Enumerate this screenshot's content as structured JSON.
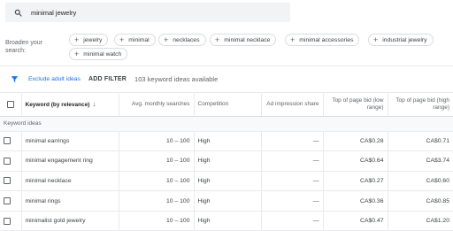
{
  "search": {
    "query": "minimal jewelry"
  },
  "broaden": {
    "label": "Broaden your search:",
    "chips": [
      {
        "label": "jewelry"
      },
      {
        "label": "minimal"
      },
      {
        "label": "necklaces"
      },
      {
        "label": "minimal necklace"
      },
      {
        "label": "minimal accessories"
      },
      {
        "label": "industrial jewelry"
      },
      {
        "label": "minimal watch"
      }
    ]
  },
  "toolbar": {
    "exclude_adult": "Exclude adult ideas",
    "add_filter": "ADD FILTER",
    "available": "103 keyword ideas available"
  },
  "table": {
    "headers": {
      "keyword": "Keyword (by relevance)",
      "searches": "Avg. monthly searches",
      "competition": "Competition",
      "impression": "Ad impression share",
      "bid_low": "Top of page bid (low range)",
      "bid_high": "Top of page bid (high range)"
    },
    "group_label": "Keyword ideas",
    "rows": [
      {
        "keyword": "minimal earrings",
        "searches": "10 – 100",
        "competition": "High",
        "impression": "—",
        "bid_low": "CA$0.28",
        "bid_high": "CA$0.71"
      },
      {
        "keyword": "minimal engagement ring",
        "searches": "10 – 100",
        "competition": "High",
        "impression": "—",
        "bid_low": "CA$0.64",
        "bid_high": "CA$3.74"
      },
      {
        "keyword": "minimal necklace",
        "searches": "10 – 100",
        "competition": "High",
        "impression": "—",
        "bid_low": "CA$0.27",
        "bid_high": "CA$0.60"
      },
      {
        "keyword": "minimal rings",
        "searches": "10 – 100",
        "competition": "High",
        "impression": "—",
        "bid_low": "CA$0.36",
        "bid_high": "CA$0.85"
      },
      {
        "keyword": "minimalist gold jewelry",
        "searches": "10 – 100",
        "competition": "High",
        "impression": "—",
        "bid_low": "CA$0.47",
        "bid_high": "CA$1.20"
      }
    ]
  },
  "colors": {
    "accent": "#1a73e8",
    "search_bg": "#f1f3f4",
    "text": "#202124",
    "muted": "#5f6368"
  }
}
